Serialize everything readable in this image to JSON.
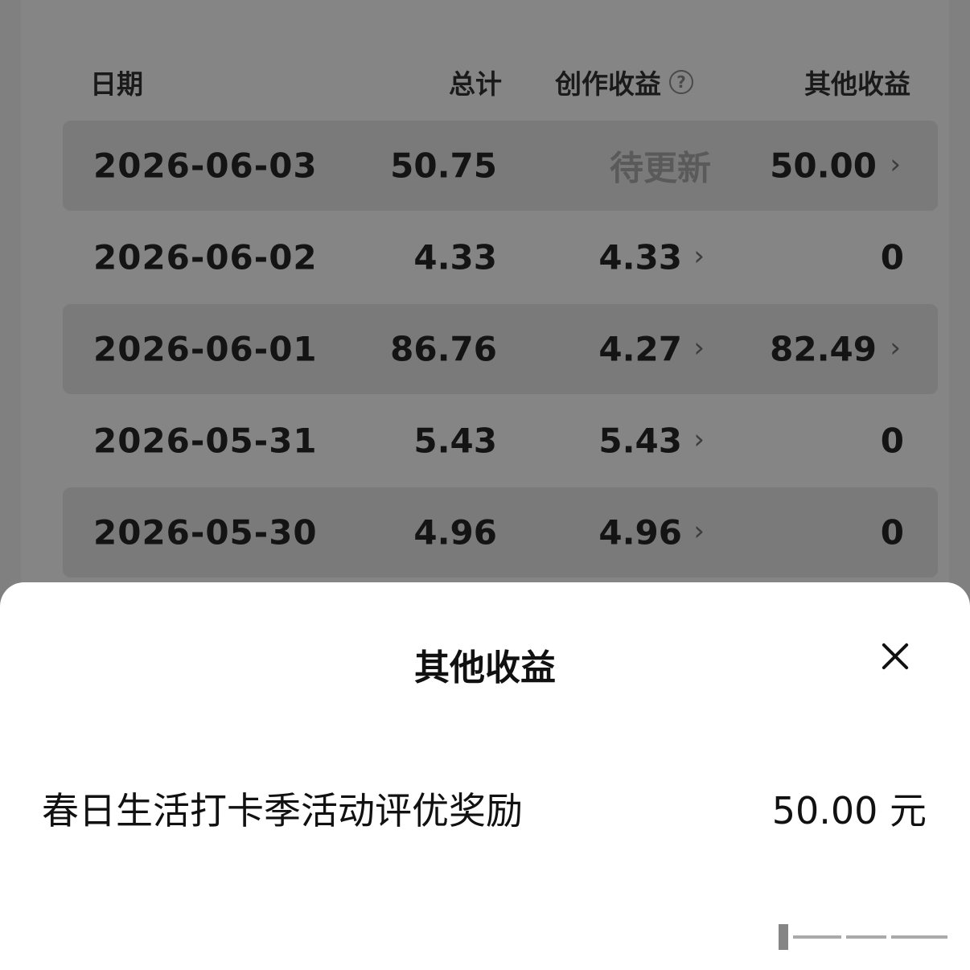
{
  "table": {
    "headers": {
      "date": "日期",
      "total": "总计",
      "creation": "创作收益",
      "creation_help": "?",
      "other": "其他收益"
    },
    "rows": [
      {
        "date": "2026-06-03",
        "total": "50.75",
        "creation": "待更新",
        "other": "50.00"
      },
      {
        "date": "2026-06-02",
        "total": "4.33",
        "creation": "4.33",
        "other": "0"
      },
      {
        "date": "2026-06-01",
        "total": "86.76",
        "creation": "4.27",
        "other": "82.49"
      },
      {
        "date": "2026-05-31",
        "total": "5.43",
        "creation": "5.43",
        "other": "0"
      },
      {
        "date": "2026-05-30",
        "total": "4.96",
        "creation": "4.96",
        "other": "0"
      }
    ],
    "chevron": "›"
  },
  "sheet": {
    "title": "其他收益",
    "item_label": "春日生活打卡季活动评优奖励",
    "item_amount": "50.00 元"
  }
}
